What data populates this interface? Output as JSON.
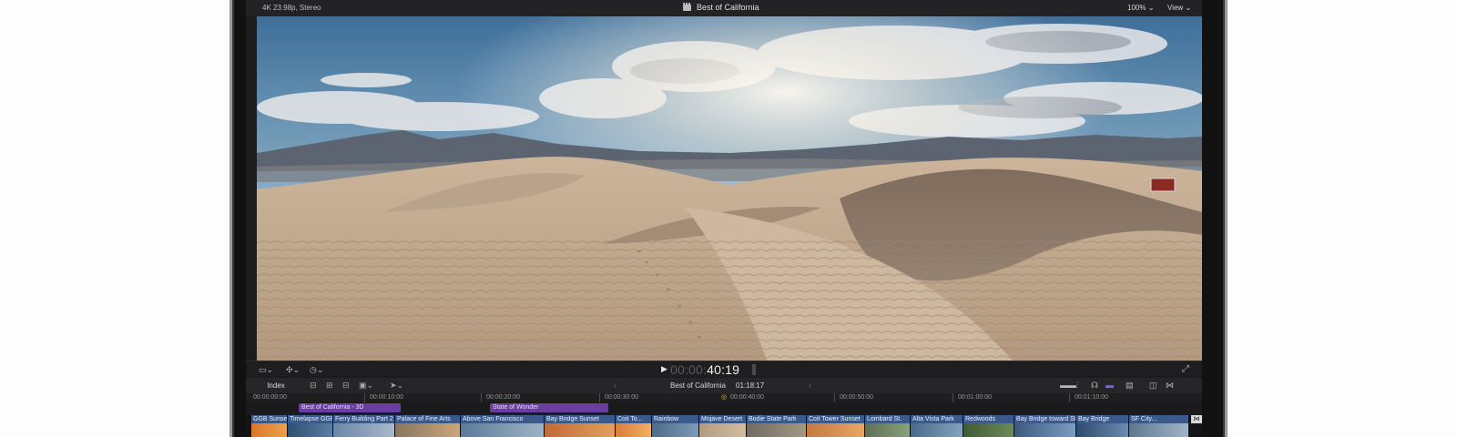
{
  "viewer": {
    "format": "4K 23.98p, Stereo",
    "title": "Best of California",
    "zoom": "100%",
    "view_menu": "View"
  },
  "transport": {
    "timecode_dim": "00:00:",
    "timecode_main": "40:19"
  },
  "timeline": {
    "index_label": "Index",
    "title": "Best of California",
    "duration": "01:18:17"
  },
  "ruler": {
    "labels": [
      "00:00:00:00",
      "00:00:10:00",
      "00:00:20:00",
      "00:00:30:00",
      "00:00:40:00",
      "00:00:50:00",
      "00:01:00:00",
      "00:01:10:00"
    ]
  },
  "stories": [
    {
      "label": "Best of California - 3D"
    },
    {
      "label": "State of Wonder"
    }
  ],
  "clips": [
    {
      "label": "GGB Sunset"
    },
    {
      "label": "Timelapse GGB"
    },
    {
      "label": "Ferry Building Part 2"
    },
    {
      "label": "Palace of Fine Arts"
    },
    {
      "label": "Above San Francisco"
    },
    {
      "label": "Bay Bridge Sunset"
    },
    {
      "label": "Coit To..."
    },
    {
      "label": "Rainbow"
    },
    {
      "label": "Mojave Desert"
    },
    {
      "label": "Bodie State Park"
    },
    {
      "label": "Coit Tower Sunset"
    },
    {
      "label": "Lombard St."
    },
    {
      "label": "Alta Vista Park"
    },
    {
      "label": "Redwoods"
    },
    {
      "label": "Bay Bridge toward SF"
    },
    {
      "label": "Bay Bridge"
    },
    {
      "label": "SF City..."
    }
  ],
  "colors": {
    "app_bg": "#1c1c1e",
    "story_purple": "#6a3ea0",
    "clip_blue": "#3a5a8c",
    "accent": "#6f6af5"
  }
}
